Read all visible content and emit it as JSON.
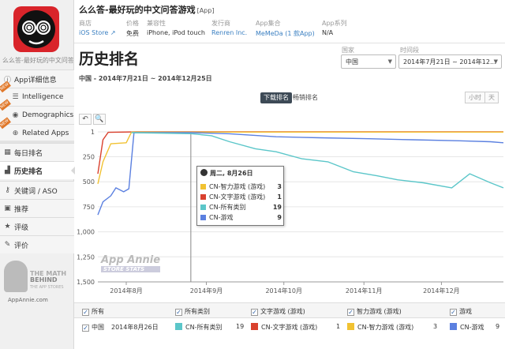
{
  "app": {
    "title": "么么答-最好玩的中文问答游戏",
    "tag": "[App]",
    "sidebar_name": "么么答-最好玩的中文问答游戏"
  },
  "meta": [
    {
      "label": "商店",
      "value": "iOS Store ↗"
    },
    {
      "label": "价格",
      "value": "免费"
    },
    {
      "label": "兼容性",
      "value": "iPhone, iPod touch"
    },
    {
      "label": "发行商",
      "value": "Renren Inc."
    },
    {
      "label": "App集合",
      "value": "MeMeDa (1 款App)"
    },
    {
      "label": "App系列",
      "value": "N/A"
    }
  ],
  "nav": [
    {
      "label": "App详细信息",
      "icon": "info-icon"
    },
    {
      "label": "Intelligence",
      "icon": "intelligence-icon",
      "badge": "NEW"
    },
    {
      "label": "Demographics",
      "icon": "demographics-icon",
      "badge": "NEW"
    },
    {
      "label": "Related Apps",
      "icon": "related-apps-icon",
      "badge": "NEW"
    },
    {
      "label": "每日排名",
      "icon": "calendar-icon"
    },
    {
      "label": "历史排名",
      "icon": "history-icon"
    },
    {
      "label": "关键词 / ASO",
      "icon": "key-icon"
    },
    {
      "label": "推荐",
      "icon": "recommend-icon"
    },
    {
      "label": "评级",
      "icon": "star-icon"
    },
    {
      "label": "评价",
      "icon": "comment-icon"
    }
  ],
  "promo": {
    "line1": "THE MATH",
    "line2": "BEHIND",
    "line3": "THE APP STORES",
    "url": "AppAnnie.com"
  },
  "page": {
    "title": "历史排名",
    "subtitle": "中国 - 2014年7月21日 ~ 2014年12月25日"
  },
  "filters": {
    "country_label": "国家",
    "country_value": "中国",
    "range_label": "时间段",
    "range_value": "2014年7月21日 ~ 2014年12..."
  },
  "toolbar": {
    "downloads_tab": "下载排名",
    "revenue_tab": "畅销排名",
    "hour": "小时",
    "day": "天",
    "undo": "↶",
    "zoom": "🔍"
  },
  "watermark": {
    "line1": "App Annie",
    "line2": "STORE STATS"
  },
  "tooltip": {
    "date": "周二, 8月26日",
    "rows": [
      {
        "name": "CN-智力游戏 (游戏)",
        "value": "3",
        "color": "#f1c232"
      },
      {
        "name": "CN-文字游戏 (游戏)",
        "value": "1",
        "color": "#d9412e"
      },
      {
        "name": "CN-所有类别",
        "value": "19",
        "color": "#5bc6c9"
      },
      {
        "name": "CN-游戏",
        "value": "9",
        "color": "#5b80e0"
      }
    ]
  },
  "colors": {
    "all": "#5bc6c9",
    "word": "#d9412e",
    "puzzle": "#f1c232",
    "games": "#5b80e0"
  },
  "chart_data": {
    "type": "line",
    "x_ticks": [
      "2014年8月",
      "2014年9月",
      "2014年10月",
      "2014年11月",
      "2014年12月"
    ],
    "y_ticks": [
      "1",
      "250",
      "500",
      "750",
      "1,000",
      "1,250",
      "1,500"
    ],
    "ylim": [
      1,
      1500
    ],
    "y_inverted": true,
    "xlim": [
      "2014-07-21",
      "2014-12-25"
    ],
    "series": [
      {
        "name": "CN-文字游戏 (游戏)",
        "color": "#d9412e",
        "points": [
          [
            "2014-07-21",
            420
          ],
          [
            "2014-07-23",
            80
          ],
          [
            "2014-07-25",
            6
          ],
          [
            "2014-08-05",
            1
          ],
          [
            "2014-12-25",
            1
          ]
        ]
      },
      {
        "name": "CN-智力游戏 (游戏)",
        "color": "#f1c232",
        "points": [
          [
            "2014-07-21",
            520
          ],
          [
            "2014-07-23",
            300
          ],
          [
            "2014-07-26",
            120
          ],
          [
            "2014-08-01",
            110
          ],
          [
            "2014-08-03",
            3
          ],
          [
            "2014-12-25",
            3
          ]
        ]
      },
      {
        "name": "CN-游戏",
        "color": "#5b80e0",
        "points": [
          [
            "2014-07-21",
            830
          ],
          [
            "2014-07-23",
            700
          ],
          [
            "2014-07-26",
            640
          ],
          [
            "2014-07-28",
            560
          ],
          [
            "2014-07-31",
            600
          ],
          [
            "2014-08-02",
            570
          ],
          [
            "2014-08-04",
            9
          ],
          [
            "2014-08-26",
            9
          ],
          [
            "2014-09-10",
            20
          ],
          [
            "2014-09-28",
            50
          ],
          [
            "2014-10-15",
            60
          ],
          [
            "2014-11-03",
            70
          ],
          [
            "2014-11-20",
            80
          ],
          [
            "2014-12-08",
            90
          ],
          [
            "2014-12-20",
            100
          ],
          [
            "2014-12-25",
            110
          ]
        ]
      },
      {
        "name": "CN-所有类别",
        "color": "#5bc6c9",
        "points": [
          [
            "2014-08-03",
            9
          ],
          [
            "2014-08-26",
            19
          ],
          [
            "2014-09-03",
            40
          ],
          [
            "2014-09-10",
            100
          ],
          [
            "2014-09-20",
            170
          ],
          [
            "2014-09-28",
            200
          ],
          [
            "2014-10-08",
            270
          ],
          [
            "2014-10-18",
            300
          ],
          [
            "2014-10-28",
            400
          ],
          [
            "2014-11-06",
            440
          ],
          [
            "2014-11-14",
            480
          ],
          [
            "2014-11-24",
            510
          ],
          [
            "2014-12-05",
            560
          ],
          [
            "2014-12-12",
            420
          ],
          [
            "2014-12-20",
            510
          ],
          [
            "2014-12-25",
            560
          ]
        ]
      }
    ]
  },
  "legend": {
    "header": [
      {
        "label": "所有"
      },
      {
        "label": "所有类别"
      },
      {
        "label": "文字游戏 (游戏)"
      },
      {
        "label": "智力游戏 (游戏)"
      },
      {
        "label": "游戏"
      }
    ],
    "row": {
      "country": "中国",
      "date": "2014年8月26日",
      "entries": [
        {
          "name": "CN-所有类别",
          "value": "19",
          "color": "#5bc6c9"
        },
        {
          "name": "CN-文字游戏 (游戏)",
          "value": "1",
          "color": "#d9412e"
        },
        {
          "name": "CN-智力游戏 (游戏)",
          "value": "3",
          "color": "#f1c232"
        },
        {
          "name": "CN-游戏",
          "value": "9",
          "color": "#5b80e0"
        }
      ]
    }
  }
}
